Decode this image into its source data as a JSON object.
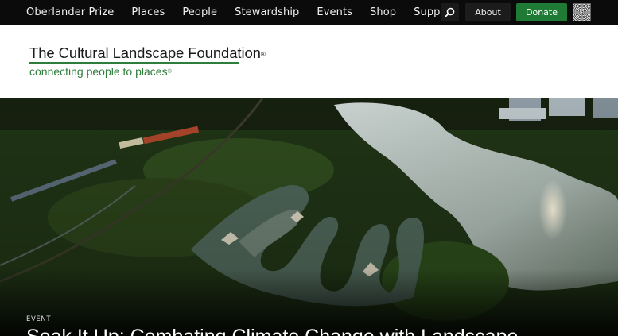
{
  "nav": {
    "items": [
      {
        "label": "Oberlander Prize",
        "name": "nav-item-oberlander-prize"
      },
      {
        "label": "Places",
        "name": "nav-item-places"
      },
      {
        "label": "People",
        "name": "nav-item-people"
      },
      {
        "label": "Stewardship",
        "name": "nav-item-stewardship"
      },
      {
        "label": "Events",
        "name": "nav-item-events"
      },
      {
        "label": "Shop",
        "name": "nav-item-shop"
      },
      {
        "label": "Support",
        "name": "nav-item-support"
      }
    ],
    "search_icon": "search-icon",
    "about_label": "About",
    "donate_label": "Donate"
  },
  "logo": {
    "title": "The Cultural Landscape Foundation",
    "tagline": "connecting people to places",
    "mark": "®"
  },
  "hero": {
    "eyebrow": "EVENT",
    "title": "Soak It Up: Combating Climate Change with Landscape"
  },
  "colors": {
    "nav_bg": "#0b0b0b",
    "donate_green": "#1f7a33",
    "brand_green": "#2e7d3a"
  }
}
